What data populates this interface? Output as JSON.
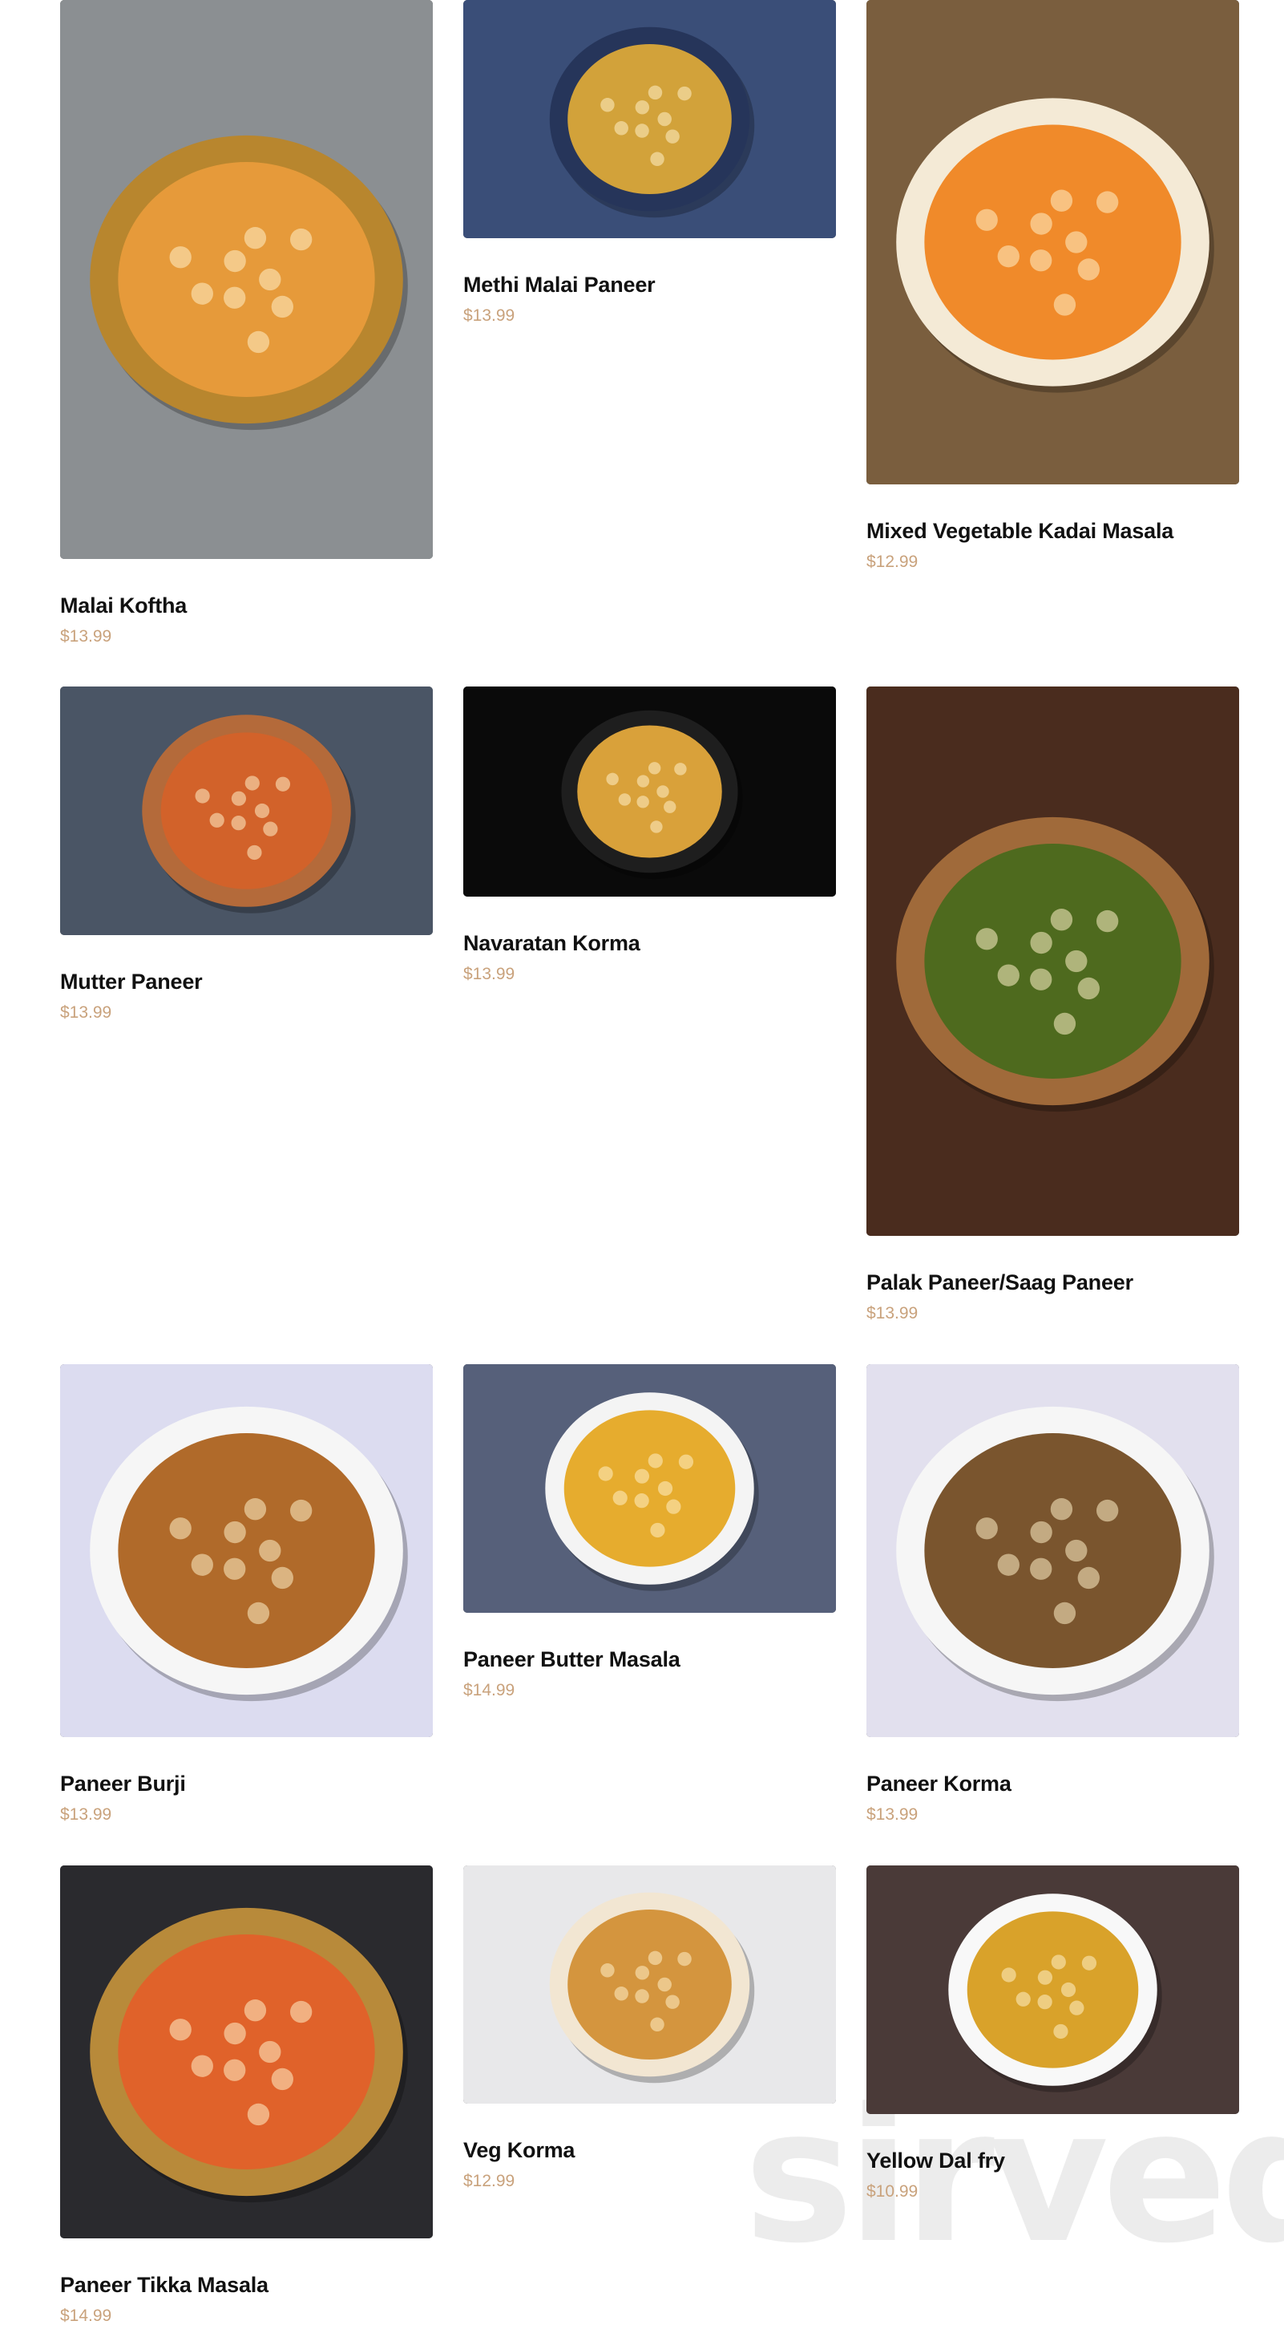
{
  "menu": {
    "items": [
      {
        "name": "Malai Koftha",
        "price": "$13.99",
        "icon": "malai-koftha-photo",
        "bg": "#8b8f92",
        "pan": "#b8862e",
        "curry": "#e69a3a"
      },
      {
        "name": "Methi Malai Paneer",
        "price": "$13.99",
        "icon": "methi-malai-paneer-photo",
        "bg": "#3a4e78",
        "pan": "#26355a",
        "curry": "#d2a23a"
      },
      {
        "name": "Mixed Vegetable Kadai Masala",
        "price": "$12.99",
        "icon": "mixed-vegetable-kadai-masala-photo",
        "bg": "#7a5e3e",
        "pan": "#f4ead6",
        "curry": "#f08a2a"
      },
      {
        "name": "Mutter Paneer",
        "price": "$13.99",
        "icon": "mutter-paneer-photo",
        "bg": "#4a5565",
        "pan": "#b46a3a",
        "curry": "#d2622a"
      },
      {
        "name": "Navaratan Korma",
        "price": "$13.99",
        "icon": "navaratan-korma-photo",
        "bg": "#0a0a0a",
        "pan": "#1e1e1e",
        "curry": "#d9a13a"
      },
      {
        "name": "Palak Paneer/Saag Paneer",
        "price": "$13.99",
        "icon": "palak-paneer-photo",
        "bg": "#4a2c1e",
        "pan": "#a06a3a",
        "curry": "#4e6a1e"
      },
      {
        "name": "Paneer Burji",
        "price": "$13.99",
        "icon": "paneer-burji-photo",
        "bg": "#dcdcf0",
        "pan": "#f6f6f6",
        "curry": "#b06a2a"
      },
      {
        "name": "Paneer Butter Masala",
        "price": "$14.99",
        "icon": "paneer-butter-masala-photo",
        "bg": "#56607a",
        "pan": "#f4f4f4",
        "curry": "#e6ac2e"
      },
      {
        "name": "Paneer Korma",
        "price": "$13.99",
        "icon": "paneer-korma-photo",
        "bg": "#e2e0ee",
        "pan": "#f6f6f6",
        "curry": "#7a552e"
      },
      {
        "name": "Paneer Tikka Masala",
        "price": "$14.99",
        "icon": "paneer-tikka-masala-photo",
        "bg": "#2a2a2e",
        "pan": "#b88a3a",
        "curry": "#e0622a"
      },
      {
        "name": "Veg Korma",
        "price": "$12.99",
        "icon": "veg-korma-photo",
        "bg": "#e8e8ea",
        "pan": "#f2e6d2",
        "curry": "#d4953e"
      },
      {
        "name": "Yellow Dal fry",
        "price": "$10.99",
        "icon": "yellow-dal-fry-photo",
        "bg": "#4a3a38",
        "pan": "#f8f8f8",
        "curry": "#d9a22a"
      }
    ]
  },
  "watermark": "sirved",
  "colors": {
    "price": "#c9a27c",
    "title": "#111111"
  }
}
